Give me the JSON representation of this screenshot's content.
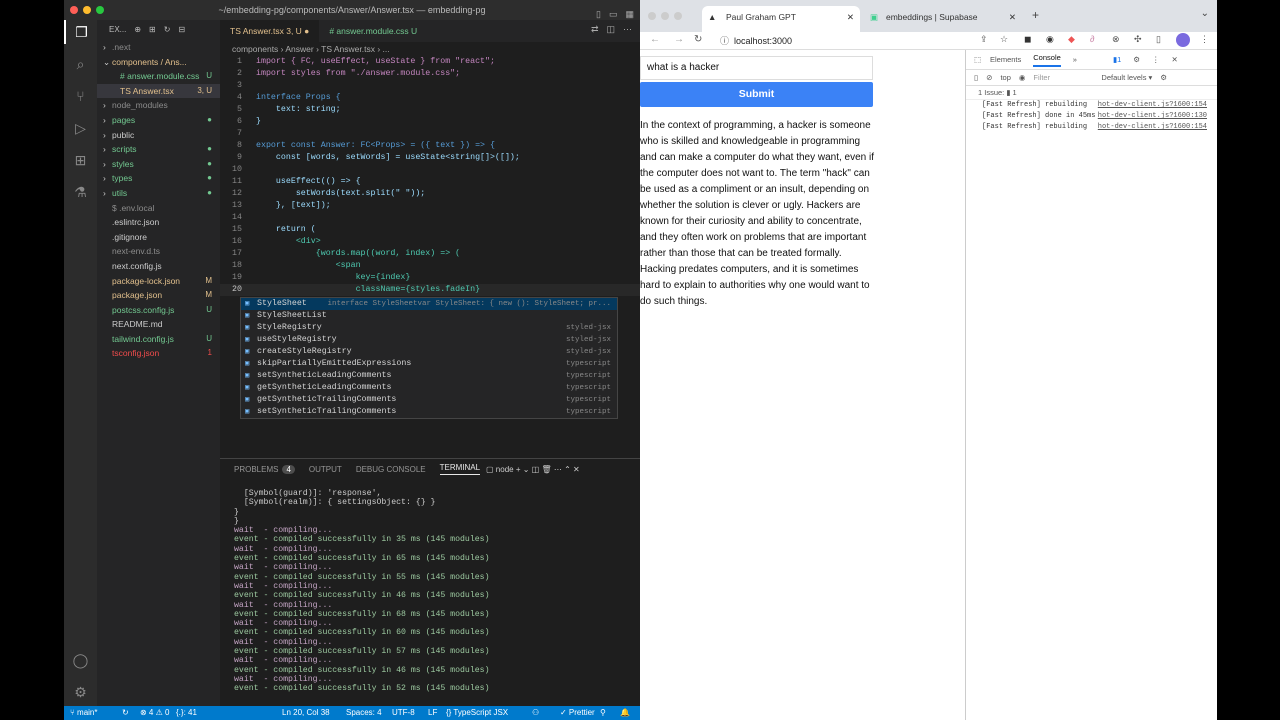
{
  "vscode": {
    "window_title": "~/embedding-pg/components/Answer/Answer.tsx — embedding-pg",
    "explorer_label": "EX...",
    "tree": [
      {
        "label": ".next",
        "badge": "",
        "color": "#8c8c8c",
        "indent": 1,
        "arrow": "›"
      },
      {
        "label": "components / Ans...",
        "badge": "",
        "color": "#e2c08d",
        "indent": 1,
        "arrow": "⌄"
      },
      {
        "label": "# answer.module.css",
        "badge": "U",
        "color": "#73c991",
        "indent": 2,
        "arrow": ""
      },
      {
        "label": "TS Answer.tsx",
        "badge": "3, U",
        "color": "#e2c08d",
        "indent": 2,
        "arrow": ""
      },
      {
        "label": "node_modules",
        "badge": "",
        "color": "#8c8c8c",
        "indent": 1,
        "arrow": "›"
      },
      {
        "label": "pages",
        "badge": "●",
        "color": "#73c991",
        "indent": 1,
        "arrow": "›"
      },
      {
        "label": "public",
        "badge": "",
        "color": "#ccc",
        "indent": 1,
        "arrow": "›"
      },
      {
        "label": "scripts",
        "badge": "●",
        "color": "#73c991",
        "indent": 1,
        "arrow": "›"
      },
      {
        "label": "styles",
        "badge": "●",
        "color": "#73c991",
        "indent": 1,
        "arrow": "›"
      },
      {
        "label": "types",
        "badge": "●",
        "color": "#73c991",
        "indent": 1,
        "arrow": "›"
      },
      {
        "label": "utils",
        "badge": "●",
        "color": "#73c991",
        "indent": 1,
        "arrow": "›"
      },
      {
        "label": "$ .env.local",
        "badge": "",
        "color": "#8c8c8c",
        "indent": 1,
        "arrow": ""
      },
      {
        "label": ".eslintrc.json",
        "badge": "",
        "color": "#ccc",
        "indent": 1,
        "arrow": ""
      },
      {
        "label": ".gitignore",
        "badge": "",
        "color": "#ccc",
        "indent": 1,
        "arrow": ""
      },
      {
        "label": "next-env.d.ts",
        "badge": "",
        "color": "#8c8c8c",
        "indent": 1,
        "arrow": ""
      },
      {
        "label": "next.config.js",
        "badge": "",
        "color": "#ccc",
        "indent": 1,
        "arrow": ""
      },
      {
        "label": "package-lock.json",
        "badge": "M",
        "color": "#e2c08d",
        "indent": 1,
        "arrow": ""
      },
      {
        "label": "package.json",
        "badge": "M",
        "color": "#e2c08d",
        "indent": 1,
        "arrow": ""
      },
      {
        "label": "postcss.config.js",
        "badge": "U",
        "color": "#73c991",
        "indent": 1,
        "arrow": ""
      },
      {
        "label": "README.md",
        "badge": "",
        "color": "#ccc",
        "indent": 1,
        "arrow": ""
      },
      {
        "label": "tailwind.config.js",
        "badge": "U",
        "color": "#73c991",
        "indent": 1,
        "arrow": ""
      },
      {
        "label": "tsconfig.json",
        "badge": "1",
        "color": "#f14c4c",
        "indent": 1,
        "arrow": ""
      }
    ],
    "tabs": {
      "active": "TS Answer.tsx 3, U ●",
      "inactive": "# answer.module.css U"
    },
    "breadcrumb": "components › Answer › TS Answer.tsx › ...",
    "code": [
      {
        "n": "1",
        "t": "import { FC, useEffect, useState } from \"react\";"
      },
      {
        "n": "2",
        "t": "import styles from \"./answer.module.css\";"
      },
      {
        "n": "3",
        "t": ""
      },
      {
        "n": "4",
        "t": "interface Props {"
      },
      {
        "n": "5",
        "t": "    text: string;"
      },
      {
        "n": "6",
        "t": "}"
      },
      {
        "n": "7",
        "t": ""
      },
      {
        "n": "8",
        "t": "export const Answer: FC<Props> = ({ text }) => {"
      },
      {
        "n": "9",
        "t": "    const [words, setWords] = useState<string[]>([]);"
      },
      {
        "n": "10",
        "t": ""
      },
      {
        "n": "11",
        "t": "    useEffect(() => {"
      },
      {
        "n": "12",
        "t": "        setWords(text.split(\" \"));"
      },
      {
        "n": "13",
        "t": "    }, [text]);"
      },
      {
        "n": "14",
        "t": ""
      },
      {
        "n": "15",
        "t": "    return ("
      },
      {
        "n": "16",
        "t": "        <div>"
      },
      {
        "n": "17",
        "t": "            {words.map((word, index) => ("
      },
      {
        "n": "18",
        "t": "                <span"
      },
      {
        "n": "19",
        "t": "                    key={index}"
      },
      {
        "n": "20",
        "t": "                    className={styles.fadeIn}"
      }
    ],
    "suggest": [
      {
        "name": "StyleSheet",
        "src": "interface StyleSheetvar StyleSheet: { new (): StyleSheet; pr..."
      },
      {
        "name": "StyleSheetList",
        "src": ""
      },
      {
        "name": "StyleRegistry",
        "src": "styled-jsx"
      },
      {
        "name": "useStyleRegistry",
        "src": "styled-jsx"
      },
      {
        "name": "createStyleRegistry",
        "src": "styled-jsx"
      },
      {
        "name": "skipPartiallyEmittedExpressions",
        "src": "typescript"
      },
      {
        "name": "setSyntheticLeadingComments",
        "src": "typescript"
      },
      {
        "name": "getSyntheticLeadingComments",
        "src": "typescript"
      },
      {
        "name": "getSyntheticTrailingComments",
        "src": "typescript"
      },
      {
        "name": "setSyntheticTrailingComments",
        "src": "typescript"
      }
    ],
    "panel_tabs": {
      "problems": "PROBLEMS",
      "problems_count": "4",
      "output": "OUTPUT",
      "debug": "DEBUG CONSOLE",
      "terminal": "TERMINAL",
      "node": "node"
    },
    "terminal": [
      "  [Symbol(guard)]: 'response',",
      "  [Symbol(realm)]: { settingsObject: {} }",
      "}",
      "}",
      "wait  - compiling...",
      "event - compiled successfully in 35 ms (145 modules)",
      "wait  - compiling...",
      "event - compiled successfully in 65 ms (145 modules)",
      "wait  - compiling...",
      "event - compiled successfully in 55 ms (145 modules)",
      "wait  - compiling...",
      "event - compiled successfully in 46 ms (145 modules)",
      "wait  - compiling...",
      "event - compiled successfully in 68 ms (145 modules)",
      "wait  - compiling...",
      "event - compiled successfully in 60 ms (145 modules)",
      "wait  - compiling...",
      "event - compiled successfully in 57 ms (145 modules)",
      "wait  - compiling...",
      "event - compiled successfully in 46 ms (145 modules)",
      "wait  - compiling...",
      "event - compiled successfully in 52 ms (145 modules)"
    ],
    "status": {
      "branch": "main*",
      "errors": "⊗ 4 ⚠ 0",
      "extra": "{.}: 41",
      "position": "Ln 20, Col 38",
      "spaces": "Spaces: 4",
      "encoding": "UTF-8",
      "eol": "LF",
      "lang": "{} TypeScript JSX",
      "prettier": "✓ Prettier"
    }
  },
  "browser": {
    "tab1": "Paul Graham GPT",
    "tab2": "embeddings | Supabase",
    "url": "localhost:3000",
    "query": "what is a hacker",
    "submit": "Submit",
    "answer": "In the context of programming, a hacker is someone who is skilled and knowledgeable in programming and can make a computer do what they want, even if the computer does not want to. The term \"hack\" can be used as a compliment or an insult, depending on whether the solution is clever or ugly. Hackers are known for their curiosity and ability to concentrate, and they often work on problems that are important rather than those that can be treated formally. Hacking predates computers, and it is sometimes hard to explain to authorities why one would want to do such things.",
    "devtools": {
      "tabs": [
        "Elements",
        "Console"
      ],
      "top": "top",
      "filter": "Filter",
      "levels": "Default levels ▾",
      "issues": "1 Issue: ▮ 1",
      "logs": [
        {
          "msg": "[Fast Refresh] rebuilding",
          "src": "hot-dev-client.js?1600:154"
        },
        {
          "msg": "[Fast Refresh] done in 45ms",
          "src": "hot-dev-client.js?1600:130"
        },
        {
          "msg": "[Fast Refresh] rebuilding",
          "src": "hot-dev-client.js?1600:154"
        }
      ]
    }
  }
}
